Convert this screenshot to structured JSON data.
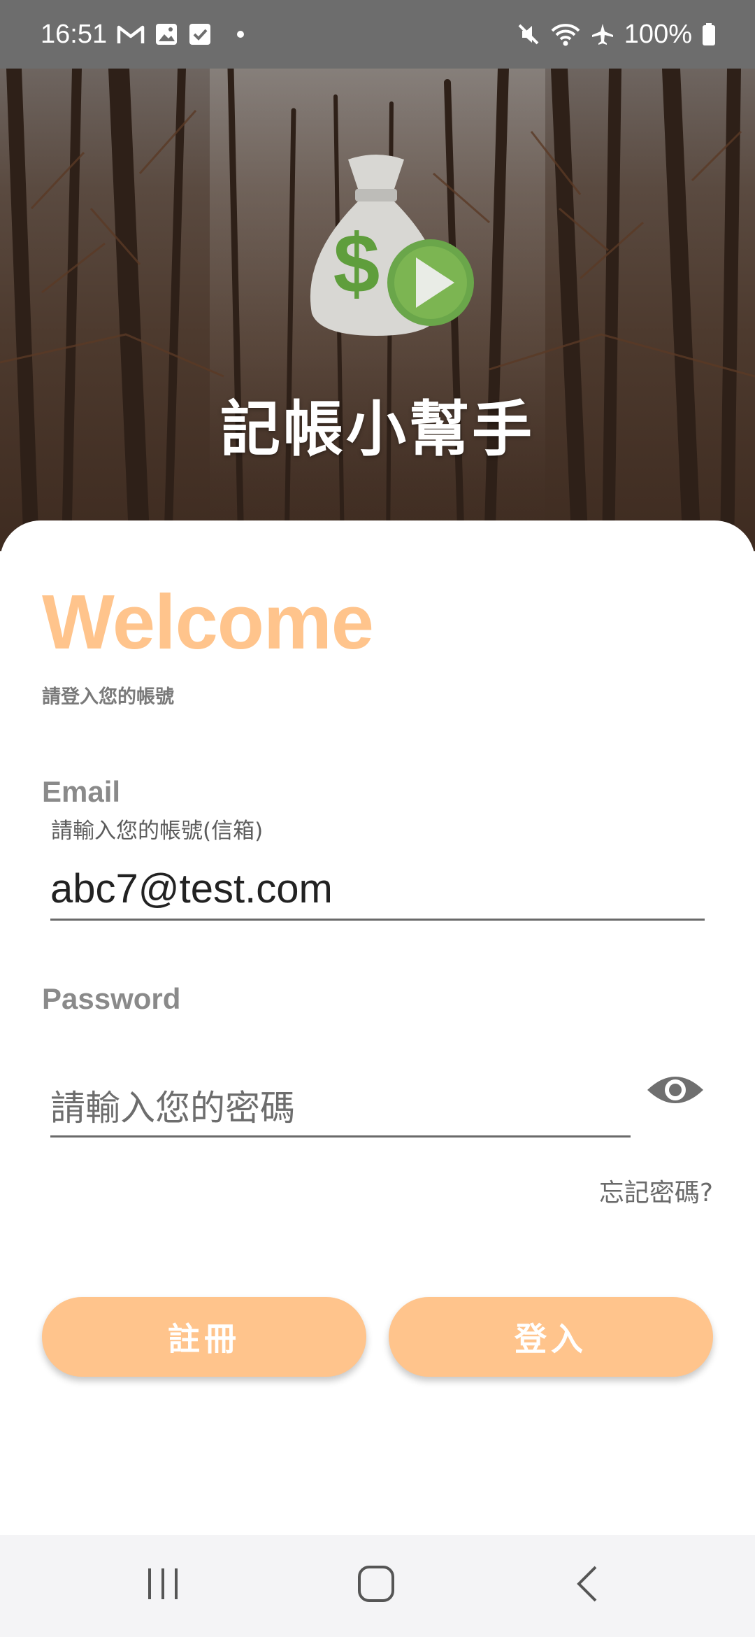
{
  "status_bar": {
    "time": "16:51",
    "left_icons": [
      "gmail-icon",
      "gallery-icon",
      "checkbox-icon",
      "dot-icon"
    ],
    "right_icons": [
      "mute-icon",
      "wifi-icon",
      "airplane-icon",
      "battery-icon"
    ],
    "battery": "100%"
  },
  "header": {
    "app_title": "記帳小幫手",
    "logo_icon": "money-bag-play-icon"
  },
  "login": {
    "welcome": "Welcome",
    "subtitle": "請登入您的帳號",
    "email_label": "Email",
    "email_hint": "請輸入您的帳號(信箱)",
    "email_value": "abc7@test.com",
    "password_label": "Password",
    "password_placeholder": "請輸入您的密碼",
    "password_value": "",
    "forgot_password": "忘記密碼?",
    "register_button": "註冊",
    "login_button": "登入"
  },
  "colors": {
    "accent": "#ffc48c",
    "status_bar": "#6d6d6d",
    "nav_bar": "#f4f4f6"
  },
  "nav_bar": {
    "buttons": [
      "recent-apps-icon",
      "home-icon",
      "back-icon"
    ]
  }
}
